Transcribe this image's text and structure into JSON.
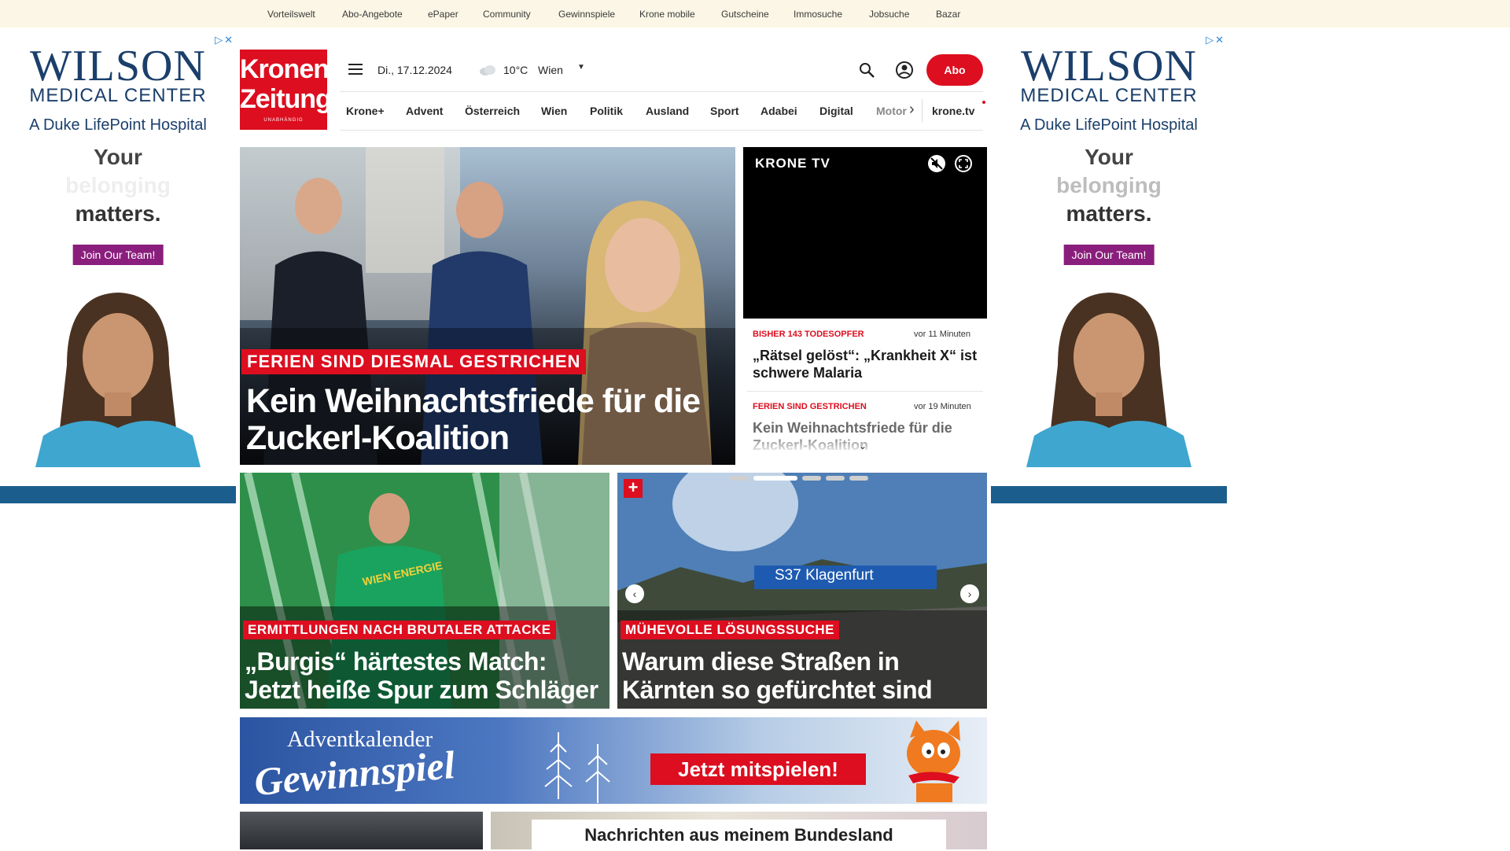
{
  "topnav": [
    "Vorteilswelt",
    "Abo-Angebote",
    "ePaper",
    "Community",
    "Gewinnspiele",
    "Krone mobile",
    "Gutscheine",
    "Immosuche",
    "Jobsuche",
    "Bazar"
  ],
  "ad": {
    "brand": "WILSON",
    "brand_sub": "MEDICAL CENTER",
    "tagline": "A Duke LifePoint Hospital",
    "line1": "Your",
    "line2": "belonging",
    "line3": "matters.",
    "button": "Join Our Team!"
  },
  "logo": {
    "line1": "Kronen",
    "line2": "Zeitung",
    "line3": "UNABHÄNGIG"
  },
  "header": {
    "date": "Di., 17.12.2024",
    "temperature": "10°C",
    "location": "Wien",
    "abo": "Abo"
  },
  "nav": [
    "Krone+",
    "Advent",
    "Österreich",
    "Wien",
    "Politik",
    "Ausland",
    "Sport",
    "Adabei",
    "Digital",
    "Motor"
  ],
  "nav_extra": "krone.tv",
  "hero": {
    "kicker": "FERIEN SIND DIESMAL GESTRICHEN",
    "title": "Kein Weihnachtsfriede für die Zuckerl-Koalition"
  },
  "video": {
    "brand": "KRONE TV"
  },
  "ticker": [
    {
      "kicker": "BISHER 143 TODESOPFER",
      "time": "vor 11 Minuten",
      "title": "„Rätsel gelöst“: „Krankheit X“ ist schwere Malaria"
    },
    {
      "kicker": "FERIEN SIND GESTRICHEN",
      "time": "vor 19 Minuten",
      "title": "Kein Weihnachtsfriede für die Zuckerl-Koalition"
    }
  ],
  "teasers": [
    {
      "kicker": "ERMITTLUNGEN NACH BRUTALER ATTACKE",
      "title": "„Burgis“ härtestes Match: Jetzt heiße Spur zum Schläger",
      "jersey": "WIEN ENERGIE"
    },
    {
      "kicker": "MÜHEVOLLE LÖSUNGSSUCHE",
      "title": "Warum diese Straßen in Kärnten so gefürchtet sind",
      "sign": "S37 Klagenfurt"
    }
  ],
  "advent": {
    "line1": "Adventkalender",
    "line2": "Gewinnspiel",
    "button": "Jetzt mitspielen!"
  },
  "bottom": {
    "title": "Nachrichten aus meinem Bundesland"
  }
}
